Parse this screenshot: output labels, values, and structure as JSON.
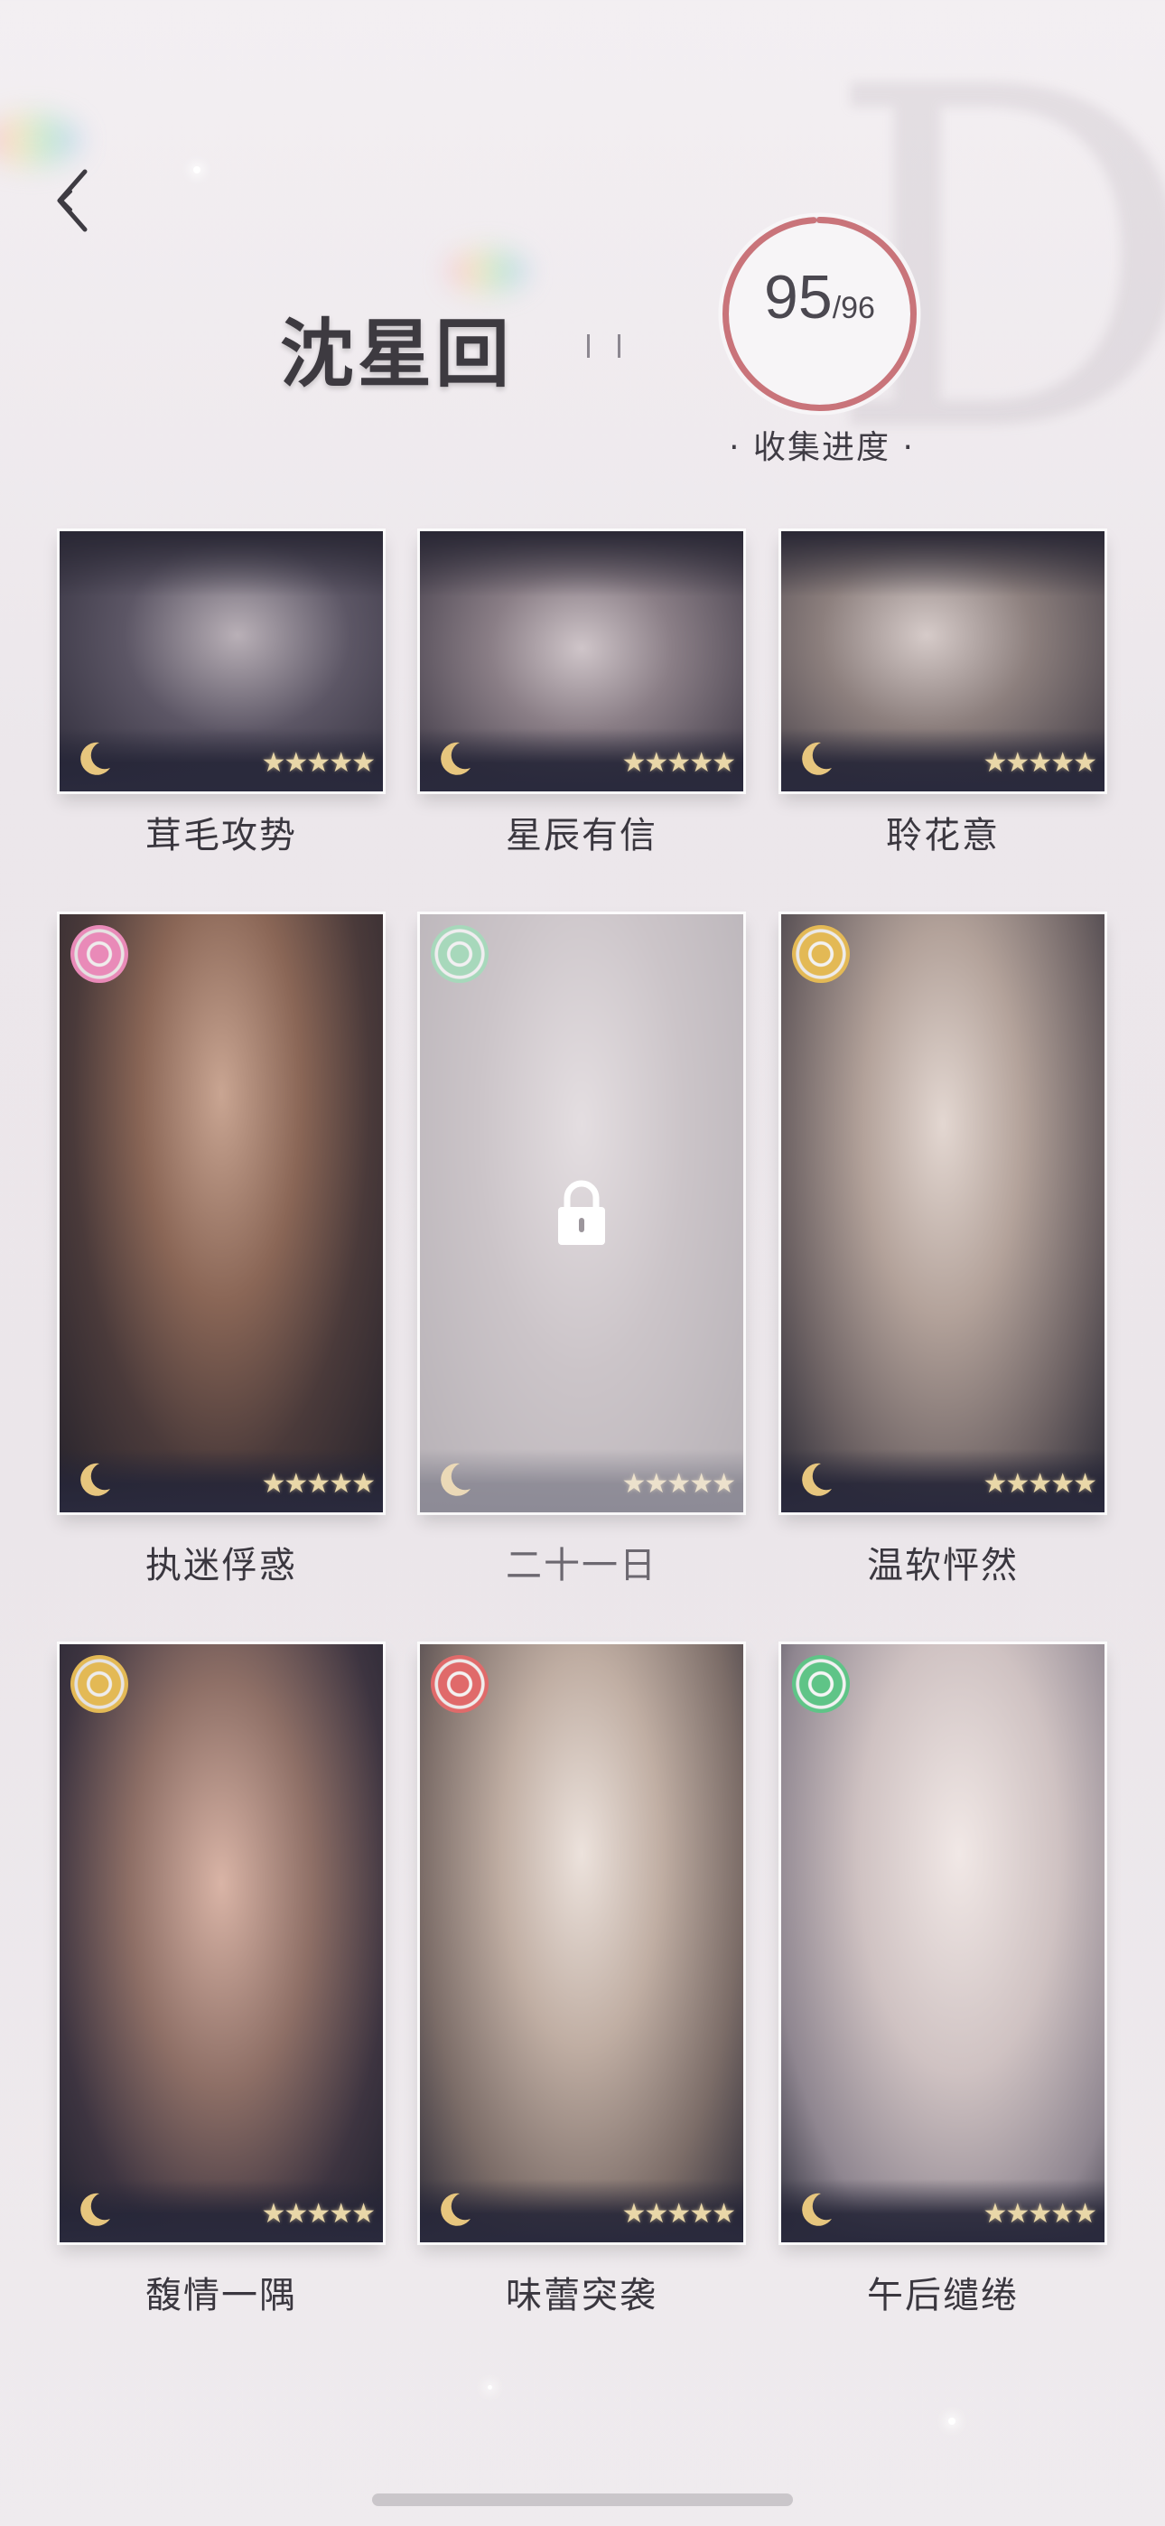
{
  "header": {
    "character_name": "沈星回",
    "progress": {
      "collected": "95",
      "total": "/96",
      "collected_value": 95,
      "total_value": 96,
      "label": "· 收集进度 ·",
      "ring_color": "#c9747a"
    }
  },
  "cards": [
    {
      "title": "茸毛攻势",
      "rarity": "★★★★★",
      "locked": false
    },
    {
      "title": "星辰有信",
      "rarity": "★★★★★",
      "locked": false
    },
    {
      "title": "聆花意",
      "rarity": "★★★★★",
      "locked": false
    },
    {
      "title": "执迷俘惑",
      "rarity": "★★★★★",
      "locked": false,
      "attribute_color": "#e98ab8"
    },
    {
      "title": "二十一日",
      "rarity": "★★★★★",
      "locked": true,
      "attribute_color": "#5fc487"
    },
    {
      "title": "温软怦然",
      "rarity": "★★★★★",
      "locked": false,
      "attribute_color": "#e3b955"
    },
    {
      "title": "馥情一隅",
      "rarity": "★★★★★",
      "locked": false,
      "attribute_color": "#e3b955"
    },
    {
      "title": "味蕾突袭",
      "rarity": "★★★★★",
      "locked": false,
      "attribute_color": "#e06a6a"
    },
    {
      "title": "午后缱绻",
      "rarity": "★★★★★",
      "locked": false,
      "attribute_color": "#5fc487"
    }
  ],
  "colors": {
    "accent_ring": "#c9747a",
    "star_gold": "#e9d7a8",
    "moon_gold": "#e7c67e"
  },
  "icons": {
    "back": "back-chevron-icon",
    "rarity_mark": "crescent-moon-icon",
    "lock": "padlock-icon",
    "attribute": "attribute-badge-icon"
  }
}
